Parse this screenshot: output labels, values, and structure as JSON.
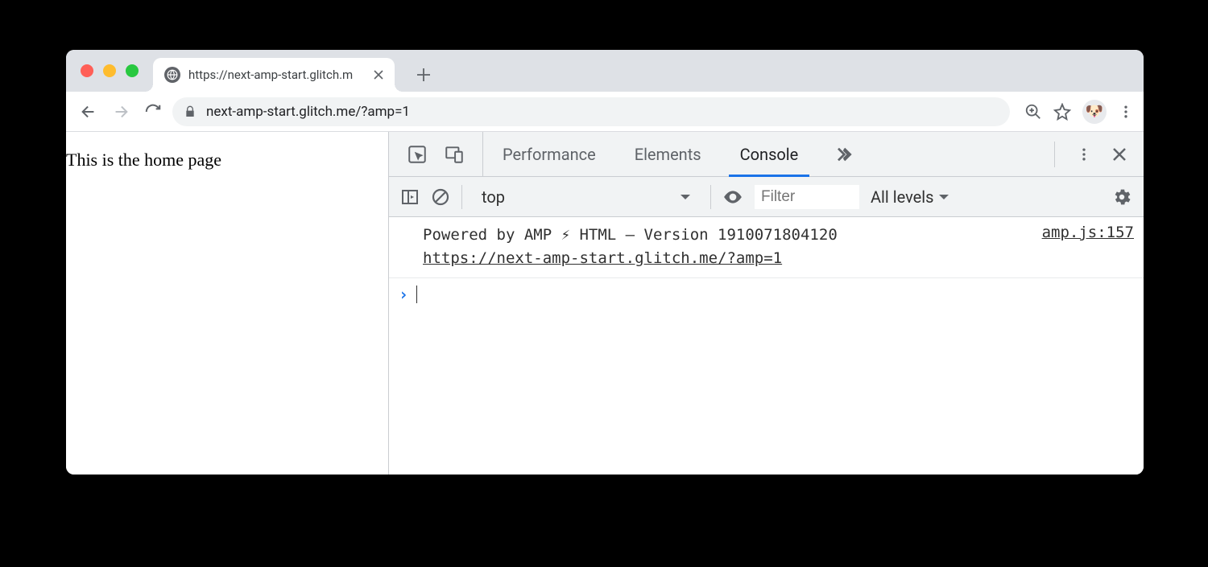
{
  "browser": {
    "tab_title": "https://next-amp-start.glitch.m",
    "url": "next-amp-start.glitch.me/?amp=1"
  },
  "page": {
    "body_text": "This is the home page"
  },
  "devtools": {
    "tabs": {
      "performance": "Performance",
      "elements": "Elements",
      "console": "Console"
    },
    "console_bar": {
      "context": "top",
      "filter_placeholder": "Filter",
      "levels_label": "All levels"
    },
    "log": {
      "message": "Powered by AMP ⚡ HTML – Version 1910071804120",
      "url": "https://next-amp-start.glitch.me/?amp=1",
      "source": "amp.js:157"
    }
  }
}
